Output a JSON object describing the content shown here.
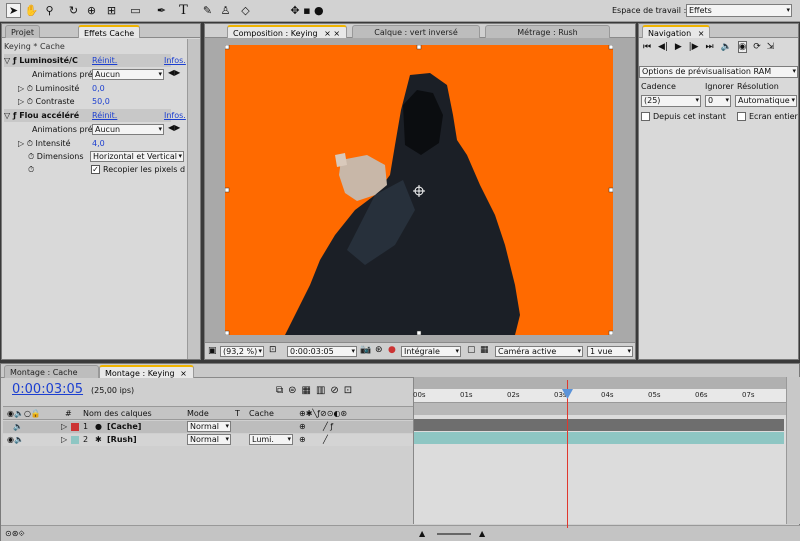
{
  "toolbar": {
    "tools": [
      "selection-icon",
      "hand-icon",
      "zoom-icon",
      "rotate-icon",
      "camera-orbit-icon",
      "pan-behind-icon",
      "rectangle-mask-icon",
      "pen-icon",
      "text-icon",
      "brush-icon",
      "clone-stamp-icon",
      "eraser-icon"
    ],
    "workspace_label": "Espace de travail :",
    "workspace_value": "Effets"
  },
  "left_panel": {
    "tabs": [
      "Projet",
      "Effets Cache"
    ],
    "breadcrumb": "Keying * Cache",
    "effects": [
      {
        "name": "Luminosité/C",
        "reset": "Réinit.",
        "info": "Infos."
      },
      {
        "name": "Flou accéléré",
        "reset": "Réinit.",
        "info": "Infos."
      }
    ],
    "anim_label": "Animations pré",
    "anim_value": "Aucun",
    "params": {
      "luminosite": {
        "label": "Luminosité",
        "value": "0,0"
      },
      "contraste": {
        "label": "Contraste",
        "value": "50,0"
      },
      "intensite": {
        "label": "Intensité",
        "value": "4,0"
      },
      "dimensions": {
        "label": "Dimensions",
        "value": "Horizontal et Vertical"
      },
      "recopier": {
        "label": "Recopier les pixels d",
        "checked": true
      }
    }
  },
  "composition": {
    "tabs": [
      "Composition : Keying",
      "Calque : vert inversé",
      "Métrage : Rush"
    ],
    "bg_color": "#ff6a00",
    "zoom": "(93,2 %)",
    "timecode": "0:00:03:05",
    "quality": "Intégrale",
    "camera": "Caméra active",
    "views": "1 vue"
  },
  "navigation": {
    "tab": "Navigation",
    "options_label": "Options de prévisualisation RAM",
    "cadence_label": "Cadence",
    "ignorer_label": "Ignorer",
    "resolution_label": "Résolution",
    "cadence_value": "(25)",
    "ignorer_value": "0",
    "resolution_value": "Automatique",
    "depuis_label": "Depuis cet instant",
    "ecran_label": "Ecran entier"
  },
  "timeline": {
    "tabs": [
      "Montage : Cache",
      "Montage : Keying"
    ],
    "timecode": "0:00:03:05",
    "fps": "(25,00 ips)",
    "columns": {
      "name": "Nom des calques",
      "mode": "Mode",
      "t": "T",
      "cache": "Cache"
    },
    "layers": [
      {
        "index": "1",
        "name": "[Cache]",
        "mode": "Normal",
        "cache": ""
      },
      {
        "index": "2",
        "name": "[Rush]",
        "mode": "Normal",
        "cache": "Lumi."
      }
    ],
    "ruler": [
      "00s",
      "01s",
      "02s",
      "03s",
      "04s",
      "05s",
      "06s",
      "07s"
    ],
    "bar_color": "#8ec6c3",
    "playhead_color": "#e0382e"
  }
}
